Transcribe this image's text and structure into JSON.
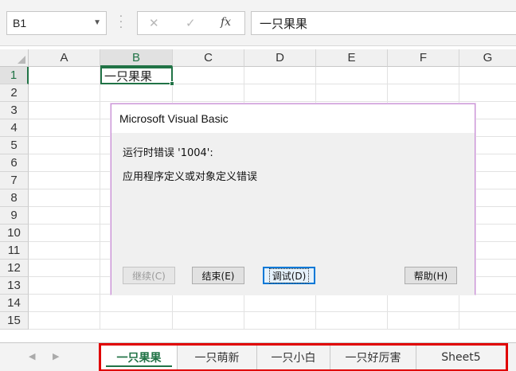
{
  "formula_bar": {
    "name_box": "B1",
    "formula": "一只果果",
    "cancel_symbol": "✕",
    "enter_symbol": "✓",
    "fx_symbol": "fx"
  },
  "grid": {
    "columns": [
      "A",
      "B",
      "C",
      "D",
      "E",
      "F",
      "G"
    ],
    "rows": [
      "1",
      "2",
      "3",
      "4",
      "5",
      "6",
      "7",
      "8",
      "9",
      "10",
      "11",
      "12",
      "13",
      "14",
      "15"
    ],
    "selected_column": "B",
    "selected_row": "1",
    "active_cell_value": "一只果果"
  },
  "dialog": {
    "title": "Microsoft Visual Basic",
    "message_line1": "运行时错误 '1004':",
    "message_line2": "应用程序定义或对象定义错误",
    "buttons": {
      "continue": "继续(C)",
      "end": "结束(E)",
      "debug": "调试(D)",
      "help": "帮助(H)"
    }
  },
  "sheet_tabs": [
    "一只果果",
    "一只萌新",
    "一只小白",
    "一只好厉害",
    "Sheet5"
  ],
  "active_sheet": "一只果果",
  "colors": {
    "excel_green": "#217346",
    "highlight_red": "#e00000",
    "dialog_border": "#c98fd6"
  }
}
